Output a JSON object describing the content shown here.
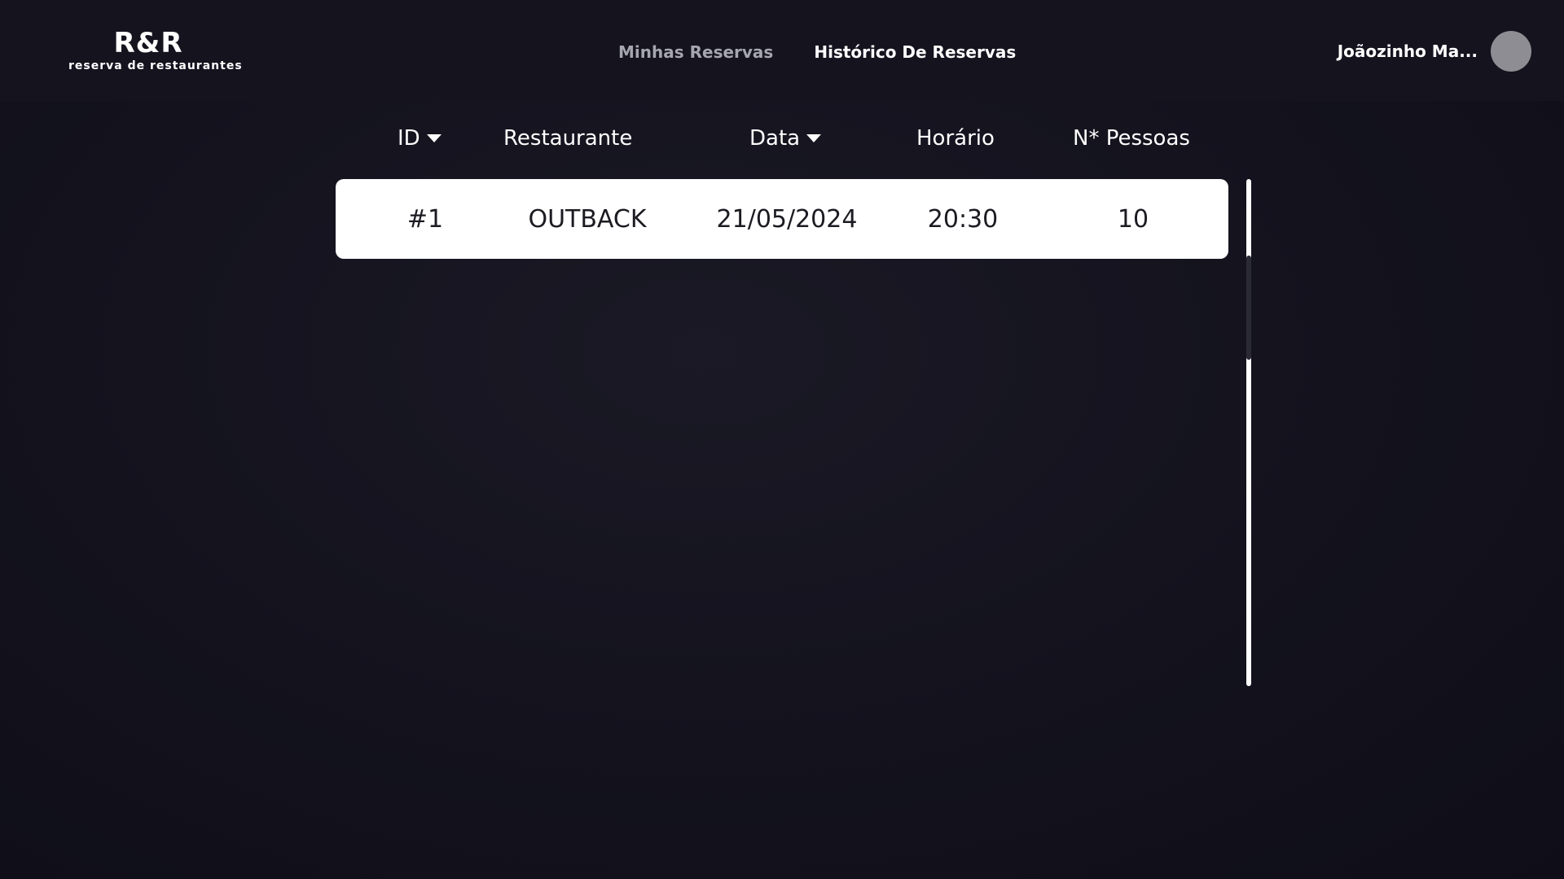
{
  "logo": {
    "title": "R&R",
    "subtitle": "reserva de restaurantes"
  },
  "nav": {
    "items": [
      {
        "label": "Minhas Reservas",
        "active": false
      },
      {
        "label": "Histórico De Reservas",
        "active": true
      }
    ]
  },
  "user": {
    "name": "Joãozinho Ma..."
  },
  "table": {
    "columns": [
      {
        "label": "ID",
        "sortable": true
      },
      {
        "label": "Restaurante",
        "sortable": false
      },
      {
        "label": "Data",
        "sortable": true
      },
      {
        "label": "Horário",
        "sortable": false
      },
      {
        "label": "N* Pessoas",
        "sortable": false
      }
    ],
    "rows": [
      {
        "id": "#1",
        "restaurante": "OUTBACK",
        "data": "21/05/2024",
        "horario": "20:30",
        "pessoas": "10"
      }
    ]
  },
  "colors": {
    "background": "#12111c",
    "row_background": "#ffffff",
    "nav_inactive": "#a6a6ae",
    "avatar": "#8e8d93"
  }
}
